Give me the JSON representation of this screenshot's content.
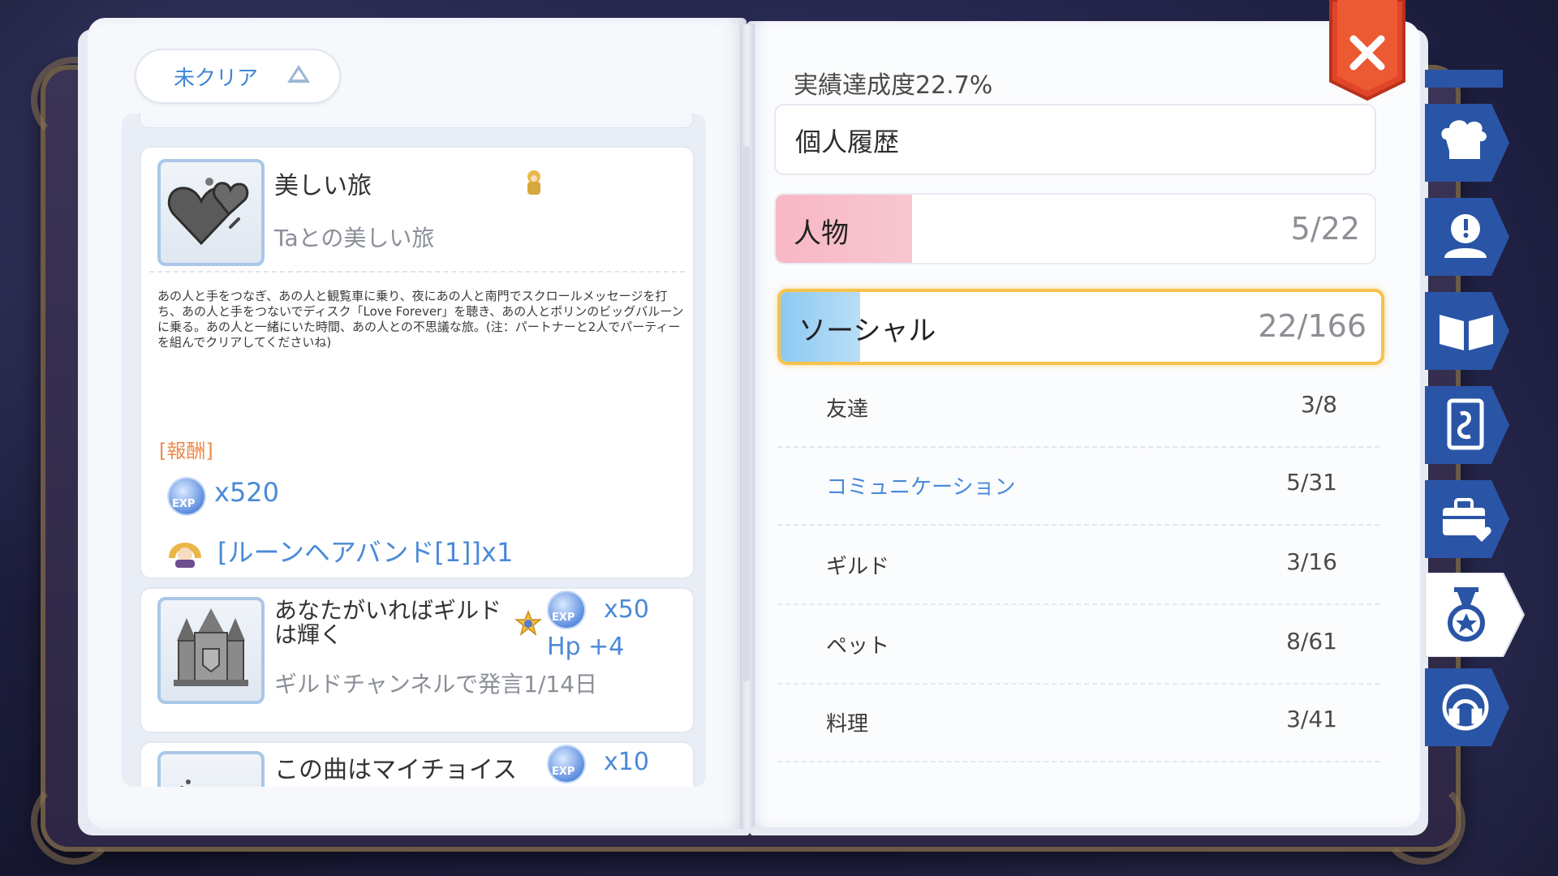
{
  "filter": {
    "label": "未クリア"
  },
  "achievements": [
    {
      "title": "美しい旅",
      "subtitle": "Taとの美しい旅",
      "description": "あの人と手をつなぎ、あの人と観覧車に乗り、夜にあの人と南門でスクロールメッセージを打ち、あの人と手をつないでディスク「Love Forever」を聴き、あの人とポリンのビッグバルーンに乗る。あの人と一緒にいた時間、あの人との不思議な旅。(注：パートナーと2人でパーティーを組んでクリアしてくださいね)",
      "reward_label": "[報酬]",
      "rewards": [
        {
          "icon": "exp-icon",
          "icon_text": "EXP",
          "value": "x520"
        },
        {
          "icon": "hairband-icon",
          "value": "[ルーンヘアバンド[1]]x1"
        }
      ]
    },
    {
      "title": "あなたがいればギルドは輝く",
      "subtitle": "ギルドチャンネルで発言1/14日",
      "rewards": [
        {
          "icon": "exp-icon",
          "icon_text": "EXP",
          "value": "x50"
        },
        {
          "icon": "hp-text",
          "value": "Hp +4"
        }
      ]
    },
    {
      "title": "この曲はマイチョイス",
      "rewards": [
        {
          "icon": "exp-icon",
          "icon_text": "EXP",
          "value": "x10"
        }
      ]
    }
  ],
  "right": {
    "rate_label": "実績達成度22.7%",
    "category": "個人履歴",
    "bars": [
      {
        "name": "人物",
        "count": "5/22",
        "progress": 0.227,
        "color": "#f8b7c4"
      },
      {
        "name": "ソーシャル",
        "count": "22/166",
        "progress": 0.133,
        "color": "#8dc9f3",
        "selected": true
      }
    ],
    "sub_items": [
      {
        "name": "友達",
        "count": "3/8"
      },
      {
        "name": "コミュニケーション",
        "count": "5/31",
        "active": true
      },
      {
        "name": "ギルド",
        "count": "3/16"
      },
      {
        "name": "ペット",
        "count": "8/61"
      },
      {
        "name": "料理",
        "count": "3/41"
      }
    ]
  },
  "side_tabs": [
    {
      "name": "chef-hat-icon",
      "selected": false
    },
    {
      "name": "profile-alert-icon",
      "selected": false
    },
    {
      "name": "open-book-icon",
      "selected": false
    },
    {
      "name": "card-icon",
      "selected": false
    },
    {
      "name": "briefcase-heart-icon",
      "selected": false
    },
    {
      "name": "medal-icon",
      "selected": true
    },
    {
      "name": "headset-icon",
      "selected": false
    }
  ],
  "colors": {
    "accent_blue": "#4a8ad8",
    "reward_orange": "#ef8a4a",
    "close_red": "#e2452a",
    "tab_blue": "#2a55a6",
    "highlight_gold": "#f6c24a"
  }
}
